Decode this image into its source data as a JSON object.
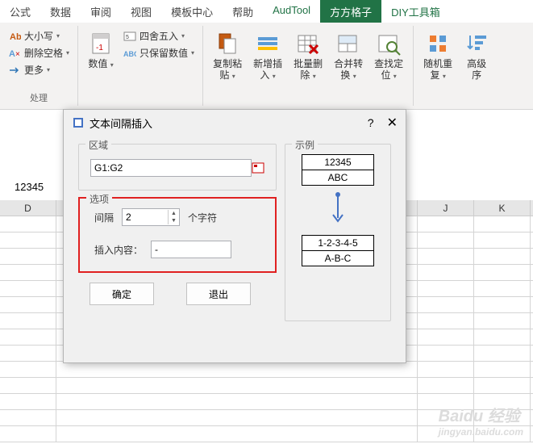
{
  "tabs": {
    "t0": "公式",
    "t1": "数据",
    "t2": "审阅",
    "t3": "视图",
    "t4": "模板中心",
    "t5": "帮助",
    "t6": "AudTool",
    "t7": "方方格子",
    "t8": "DIY工具箱"
  },
  "ribbon": {
    "g1": {
      "case": "大小写",
      "delspace": "删除空格",
      "more": "更多",
      "label": "处理"
    },
    "g2": {
      "numval": "数值",
      "round": "四舍五入",
      "keepnum": "只保留数值"
    },
    "g3": {
      "copypaste": "复制粘\n贴",
      "insert": "新增插\n入",
      "batchdel": "批量删\n除",
      "merge": "合并转\n换",
      "locate": "查找定\n位"
    },
    "g4": {
      "shuffle": "随机重\n复",
      "advsort": "高级\n序"
    }
  },
  "cell_value": "12345",
  "col_D": "D",
  "col_J": "J",
  "col_K": "K",
  "dialog": {
    "title": "文本间隔插入",
    "help": "?",
    "region_label": "区域",
    "region_value": "G1:G2",
    "options_label": "选项",
    "interval_label": "间隔",
    "interval_value": "2",
    "interval_suffix": "个字符",
    "insert_label": "插入内容：",
    "insert_value": "-",
    "ok": "确定",
    "cancel": "退出",
    "example_label": "示例",
    "ex_before_1": "12345",
    "ex_before_2": "ABC",
    "ex_after_1": "1-2-3-4-5",
    "ex_after_2": "A-B-C"
  },
  "watermark": {
    "main": "Baidu 经验",
    "sub": "jingyan.baidu.com"
  }
}
